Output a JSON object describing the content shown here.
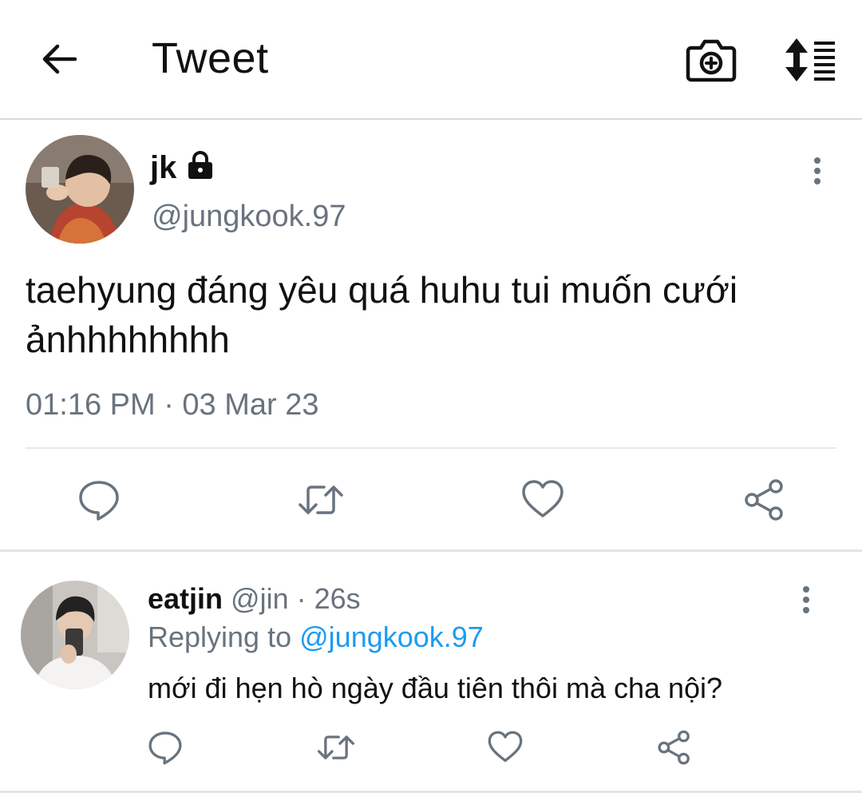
{
  "header": {
    "title": "Tweet",
    "back_icon": "arrow-left-icon",
    "camera_icon": "camera-plus-icon",
    "sort_icon": "sort-list-icon"
  },
  "tweet": {
    "display_name": "jk",
    "protected_icon": "lock-icon",
    "handle": "@jungkook.97",
    "text": "taehyung đáng yêu quá huhu tui muốn cưới ảnhhhhhhhh",
    "timestamp": "01:16 PM · 03 Mar 23",
    "actions": [
      "reply-icon",
      "retweet-icon",
      "like-icon",
      "share-icon"
    ]
  },
  "reply": {
    "display_name": "eatjin",
    "meta": "@jin · 26s",
    "replying_prefix": "Replying to",
    "replying_handle": "@jungkook.97",
    "text": "mới đi hẹn hò ngày đầu tiên thôi mà cha nội?",
    "actions": [
      "reply-icon",
      "retweet-icon",
      "like-icon",
      "share-icon"
    ]
  },
  "colors": {
    "text": "#111111",
    "muted": "#68737e",
    "accent": "#1d9bf0",
    "divider": "#e6e9ec"
  }
}
